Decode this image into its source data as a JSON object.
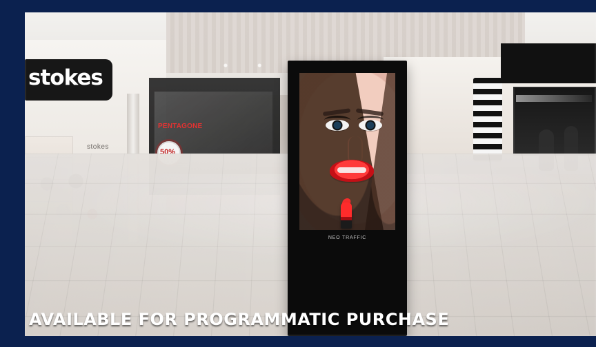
{
  "image": {
    "storefront_sign_left": "stokes",
    "storefront_sign_left_small": "stokes",
    "storefront_sign_mid": "PENTAGONE",
    "promo_text": "50%",
    "kiosk_logo_text": "NEO TRAFFIC",
    "caption": "AVAILABLE FOR PROGRAMMATIC PURCHASE"
  },
  "colors": {
    "frame_bg": "#0b214f",
    "caption": "#ffffff",
    "accent_red": "#e52a2a"
  }
}
